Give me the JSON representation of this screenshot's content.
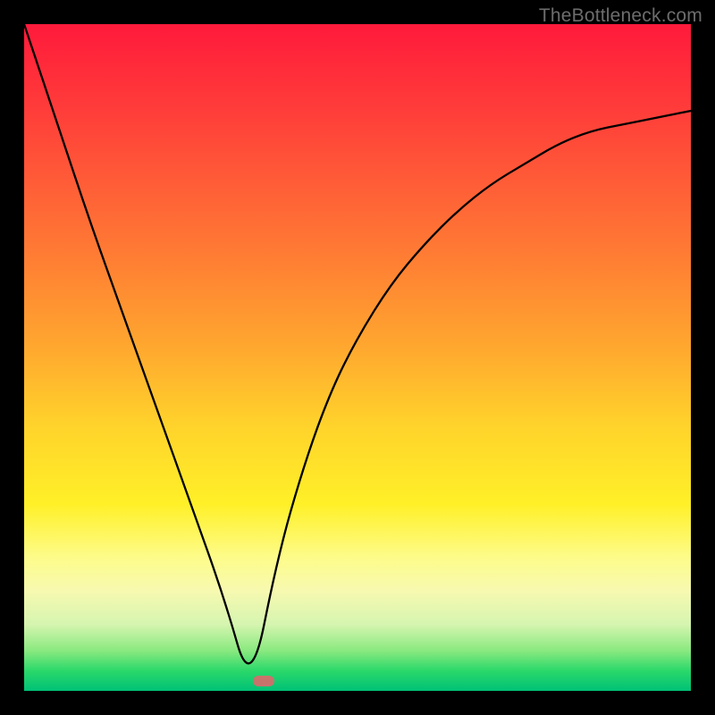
{
  "watermark": "TheBottleneck.com",
  "colors": {
    "frame": "#000000",
    "gradient_top": "#ff1a3b",
    "gradient_bottom": "#00c176",
    "curve": "#000000",
    "marker": "#d76b6b"
  },
  "chart_data": {
    "type": "line",
    "title": "",
    "xlabel": "",
    "ylabel": "",
    "xlim": [
      0,
      1
    ],
    "ylim": [
      0,
      1
    ],
    "grid": false,
    "legend": false,
    "x": [
      0.0,
      0.05,
      0.1,
      0.15,
      0.2,
      0.25,
      0.3,
      0.34,
      0.38,
      0.42,
      0.46,
      0.5,
      0.55,
      0.6,
      0.65,
      0.7,
      0.75,
      0.8,
      0.85,
      0.9,
      0.95,
      1.0
    ],
    "values": [
      1.0,
      0.85,
      0.7,
      0.56,
      0.42,
      0.28,
      0.14,
      0.0,
      0.2,
      0.34,
      0.45,
      0.53,
      0.61,
      0.67,
      0.72,
      0.76,
      0.79,
      0.82,
      0.84,
      0.85,
      0.86,
      0.87
    ],
    "bottleneck_x": 0.34,
    "annotations": []
  }
}
